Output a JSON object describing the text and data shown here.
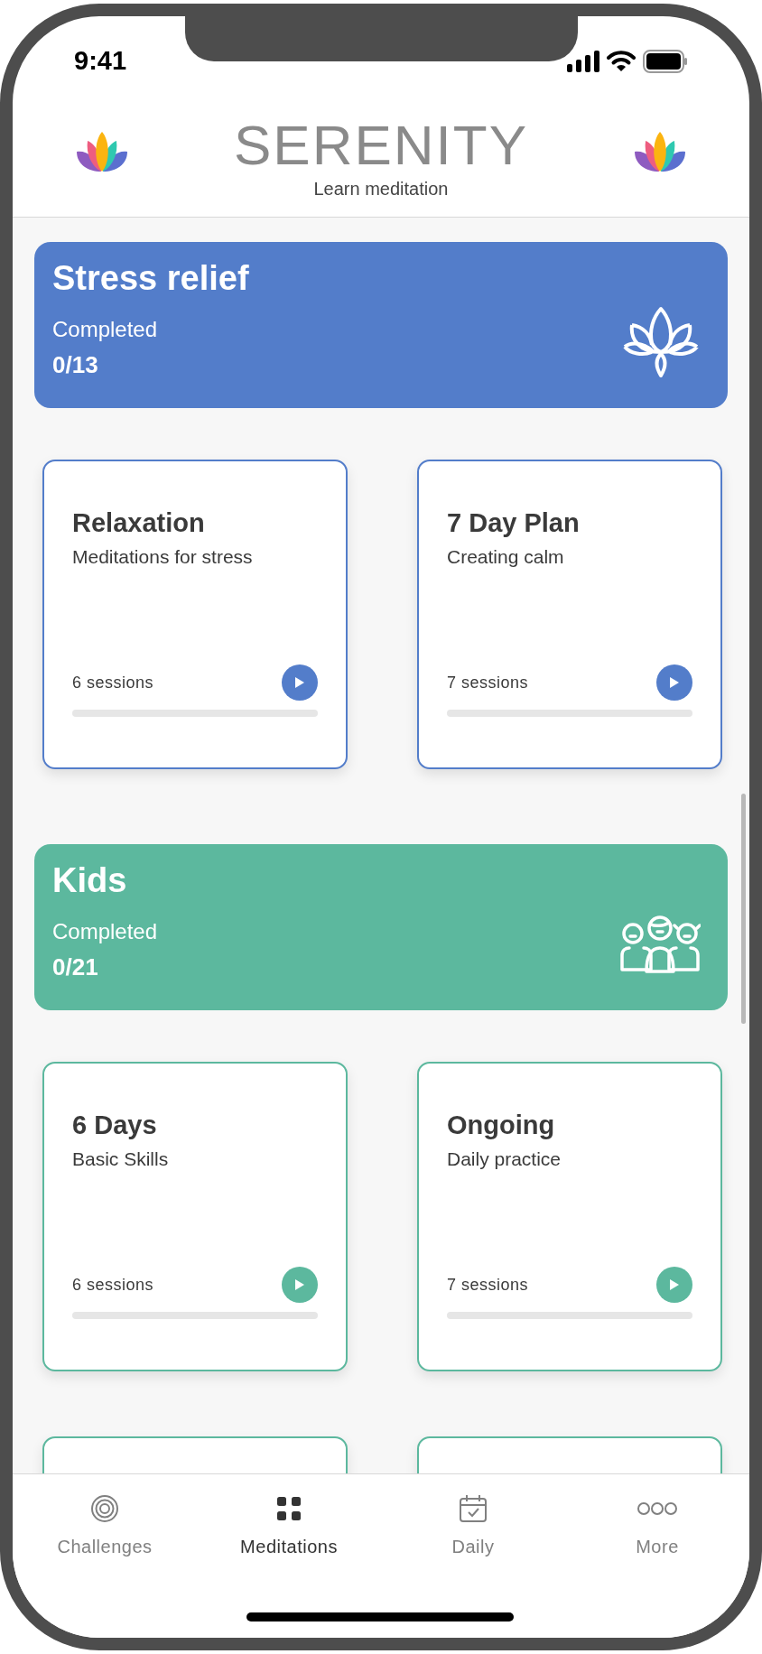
{
  "status_bar": {
    "time": "9:41"
  },
  "header": {
    "title": "SERENITY",
    "subtitle": "Learn meditation"
  },
  "sections": [
    {
      "kind": "lotus",
      "title": "Stress relief",
      "progress_label": "Completed",
      "progress": "0/13",
      "color": "#537dca",
      "cards": [
        {
          "kind": "card",
          "title": "Relaxation",
          "subtitle": "Meditations for stress",
          "sessions": "6 sessions",
          "level": 0
        },
        {
          "kind": "card",
          "title": "7 Day Plan",
          "subtitle": "Creating calm",
          "sessions": "7 sessions",
          "level": 0
        }
      ]
    },
    {
      "kind": "kids",
      "title": "Kids",
      "progress_label": "Completed",
      "progress": "0/21",
      "color": "#5cb89e",
      "cards": [
        {
          "kind": "card",
          "title": "6 Days",
          "subtitle": "Basic Skills",
          "sessions": "6 sessions",
          "level": 0
        },
        {
          "kind": "card",
          "title": "Ongoing",
          "subtitle": "Daily practice",
          "sessions": "7 sessions",
          "level": 0
        },
        {
          "kind": "partial"
        },
        {
          "kind": "partial"
        }
      ]
    }
  ],
  "tabs": [
    {
      "kind": "target",
      "label": "Challenges",
      "selected": false
    },
    {
      "kind": "grid",
      "label": "Meditations",
      "selected": true
    },
    {
      "kind": "calendar",
      "label": "Daily",
      "selected": false
    },
    {
      "kind": "dots",
      "label": "More",
      "selected": false
    }
  ]
}
